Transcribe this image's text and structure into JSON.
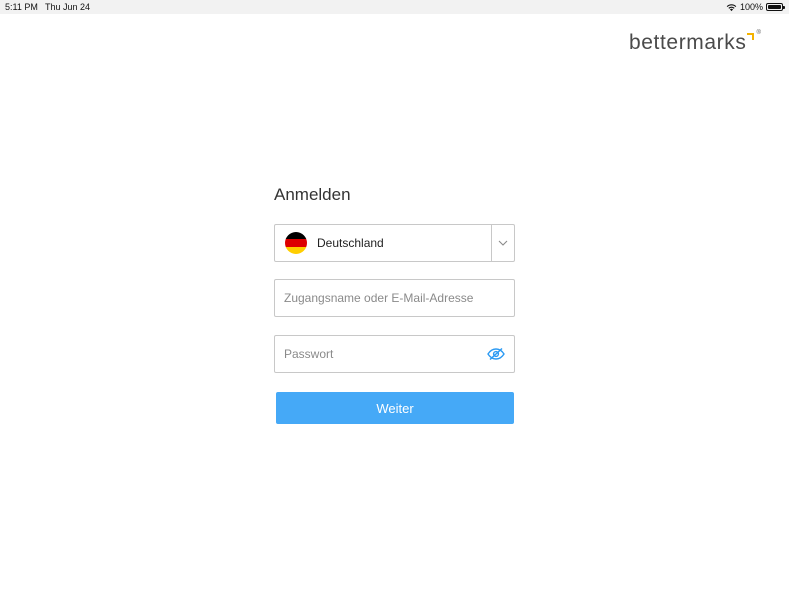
{
  "status_bar": {
    "time": "5:11 PM",
    "date": "Thu Jun 24",
    "battery_text": "100%",
    "battery_level": 1.0
  },
  "logo": {
    "text": "bettermarks",
    "registered": "®",
    "accent_color": "#f5b300"
  },
  "form": {
    "title": "Anmelden",
    "country": {
      "selected": "Deutschland",
      "flag_colors": [
        "#000000",
        "#dd0000",
        "#ffce00"
      ]
    },
    "username": {
      "value": "",
      "placeholder": "Zugangsname oder E-Mail-Adresse"
    },
    "password": {
      "value": "",
      "placeholder": "Passwort",
      "toggle_icon": "eye-slash-icon"
    },
    "submit_label": "Weiter",
    "accent_color": "#45a9f7"
  }
}
